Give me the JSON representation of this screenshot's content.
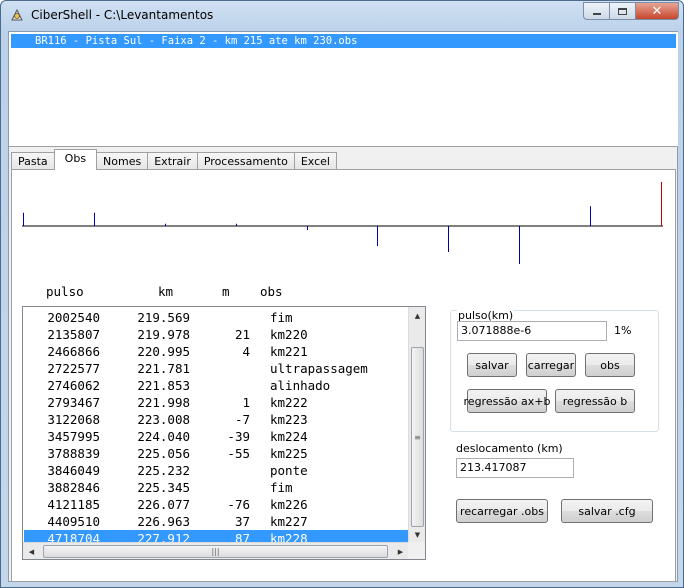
{
  "window": {
    "title": "CiberShell - C:\\Levantamentos",
    "app_icon": "cibershell-app-icon",
    "controls": {
      "minimize": "minimize-icon",
      "maximize": "maximize-icon",
      "close": "close-icon"
    }
  },
  "file_list": {
    "items": [
      "BR116 - Pista Sul - Faixa 2 - km 215 ate km 230.obs"
    ],
    "selected_index": 0
  },
  "tabs": [
    {
      "label": "Pasta",
      "active": false
    },
    {
      "label": "Obs",
      "active": true
    },
    {
      "label": "Nomes",
      "active": false
    },
    {
      "label": "Extrair",
      "active": false
    },
    {
      "label": "Processamento",
      "active": false
    },
    {
      "label": "Excel",
      "active": false
    }
  ],
  "signal_graph": {
    "markers": [
      {
        "type": "up",
        "level": 0.3
      },
      {
        "type": "up",
        "level": 0.3
      },
      {
        "type": "up",
        "level": 0.05
      },
      {
        "type": "up",
        "level": 0.05
      },
      {
        "type": "down",
        "level": 0.1
      },
      {
        "type": "down",
        "level": 0.5
      },
      {
        "type": "down",
        "level": 0.65
      },
      {
        "type": "down",
        "level": 0.95
      },
      {
        "type": "up",
        "level": 0.45
      },
      {
        "type": "up",
        "level": 1.0,
        "color": "#c00000"
      }
    ],
    "colors": {
      "axis": "#000000",
      "marker": "#0000aa",
      "end_marker": "#c00000"
    }
  },
  "table": {
    "headers": {
      "pulso": "pulso",
      "km": "km",
      "m": "m",
      "obs": "obs"
    },
    "rows": [
      {
        "pulso": "2002540",
        "km": "219.569",
        "m": "",
        "obs": "fim"
      },
      {
        "pulso": "2135807",
        "km": "219.978",
        "m": "21",
        "obs": "km220"
      },
      {
        "pulso": "2466866",
        "km": "220.995",
        "m": "4",
        "obs": "km221"
      },
      {
        "pulso": "2722577",
        "km": "221.781",
        "m": "",
        "obs": "ultrapassagem"
      },
      {
        "pulso": "2746062",
        "km": "221.853",
        "m": "",
        "obs": "alinhado"
      },
      {
        "pulso": "2793467",
        "km": "221.998",
        "m": "1",
        "obs": "km222"
      },
      {
        "pulso": "3122068",
        "km": "223.008",
        "m": "-7",
        "obs": "km223"
      },
      {
        "pulso": "3457995",
        "km": "224.040",
        "m": "-39",
        "obs": "km224"
      },
      {
        "pulso": "3788839",
        "km": "225.056",
        "m": "-55",
        "obs": "km225"
      },
      {
        "pulso": "3846049",
        "km": "225.232",
        "m": "",
        "obs": "ponte"
      },
      {
        "pulso": "3882846",
        "km": "225.345",
        "m": "",
        "obs": "fim"
      },
      {
        "pulso": "4121185",
        "km": "226.077",
        "m": "-76",
        "obs": "km226"
      },
      {
        "pulso": "4409510",
        "km": "226.963",
        "m": "37",
        "obs": "km227"
      },
      {
        "pulso": "4718704",
        "km": "227.912",
        "m": "87",
        "obs": "km228"
      }
    ],
    "selected_index": 13
  },
  "pulso_group": {
    "label": "pulso(km)",
    "value": "3.071888e-6",
    "percent": "1%",
    "buttons": {
      "salvar": "salvar",
      "carregar": "carregar",
      "obs": "obs",
      "regressao_axb": "regressão ax+b",
      "regressao_b": "regressão b"
    }
  },
  "deslocamento": {
    "label": "deslocamento (km)",
    "value": "213.417087"
  },
  "bottom_buttons": {
    "recarregar": "recarregar .obs",
    "salvar_cfg": "salvar .cfg"
  }
}
